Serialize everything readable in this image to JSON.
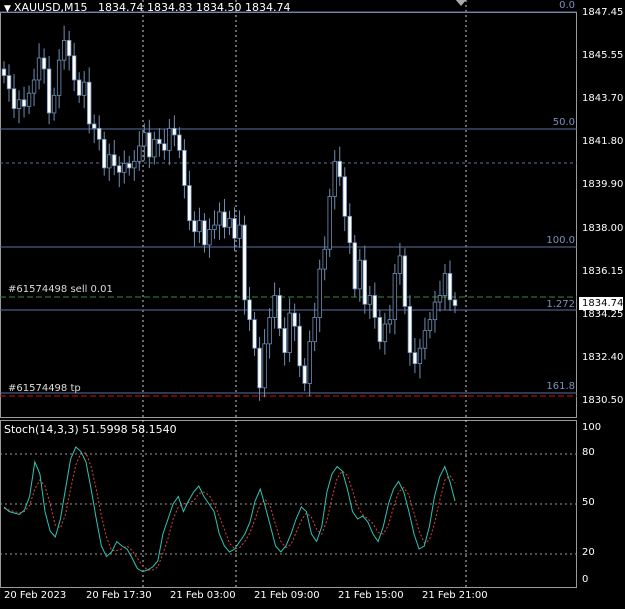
{
  "header": {
    "symbol": "XAUUSD,M15",
    "open": "1834.74",
    "high": "1834.83",
    "low": "1834.50",
    "close": "1834.74"
  },
  "price_axis": [
    "1847.45",
    "1845.55",
    "1843.70",
    "1841.80",
    "1839.90",
    "1838.00",
    "1836.15",
    "1834.25",
    "1832.40",
    "1830.50"
  ],
  "current_price": "1834.74",
  "time_axis": [
    "20 Feb 2023",
    "20 Feb 17:30",
    "21 Feb 03:00",
    "21 Feb 09:00",
    "21 Feb 15:00",
    "21 Feb 21:00"
  ],
  "fibo_labels": [
    "0.0",
    "50.0",
    "100.0",
    "1.272",
    "161.8"
  ],
  "orders": {
    "sell_label": "#61574498 sell 0.01",
    "tp_label": "#61574498 tp"
  },
  "stoch": {
    "label": "Stoch(14,3,3) 51.5998 58.1540",
    "axis": [
      "100",
      "80",
      "50",
      "20",
      "0"
    ]
  },
  "colors": {
    "background": "#000000",
    "candle": "#6f8fb5",
    "grid": "#9a9a9a",
    "fibo": "#5b6f9e",
    "sell_line": "#3a8a3a",
    "tp_line": "#d01010",
    "stoch_main": "#2ec4b6",
    "stoch_signal": "#e04040"
  },
  "chart_data": {
    "type": "candlestick",
    "symbol": "XAUUSD,M15",
    "ylim": [
      1829.9,
      1848.0
    ],
    "closes": [
      1845.2,
      1844.6,
      1843.7,
      1844.1,
      1843.8,
      1844.4,
      1845.0,
      1846.0,
      1845.5,
      1843.5,
      1844.3,
      1845.9,
      1846.8,
      1846.1,
      1845.0,
      1844.3,
      1844.9,
      1843.0,
      1842.8,
      1842.3,
      1841.0,
      1841.6,
      1841.1,
      1840.8,
      1841.2,
      1841.0,
      1841.3,
      1842.0,
      1842.6,
      1841.5,
      1842.3,
      1842.1,
      1841.8,
      1842.8,
      1842.5,
      1841.8,
      1840.2,
      1838.6,
      1838.1,
      1838.6,
      1837.5,
      1838.2,
      1838.4,
      1839.0,
      1838.3,
      1838.7,
      1837.8,
      1838.4,
      1835.0,
      1834.1,
      1832.8,
      1831.0,
      1833.0,
      1834.2,
      1835.2,
      1833.7,
      1832.6,
      1834.4,
      1833.8,
      1832.0,
      1831.2,
      1833.1,
      1834.2,
      1836.4,
      1837.3,
      1839.7,
      1841.3,
      1840.6,
      1838.8,
      1837.6,
      1835.5,
      1836.8,
      1834.8,
      1835.2,
      1834.2,
      1833.1,
      1833.9,
      1834.1,
      1836.2,
      1837.0,
      1834.7,
      1832.6,
      1832.1,
      1832.8,
      1833.6,
      1834.1,
      1834.9,
      1835.2,
      1836.2,
      1835.0,
      1834.74
    ],
    "stoch_main": [
      48,
      45,
      44,
      43,
      46,
      55,
      78,
      70,
      45,
      32,
      28,
      40,
      60,
      80,
      88,
      85,
      78,
      60,
      40,
      22,
      15,
      18,
      25,
      22,
      20,
      14,
      7,
      5,
      6,
      8,
      12,
      30,
      40,
      50,
      55,
      45,
      52,
      58,
      62,
      55,
      50,
      45,
      30,
      22,
      18,
      20,
      25,
      30,
      38,
      52,
      60,
      48,
      35,
      22,
      18,
      22,
      30,
      40,
      48,
      45,
      30,
      25,
      35,
      58,
      70,
      75,
      72,
      60,
      45,
      40,
      42,
      38,
      30,
      25,
      35,
      50,
      60,
      65,
      58,
      45,
      30,
      20,
      22,
      35,
      55,
      68,
      75,
      65,
      52
    ],
    "stoch_signal": [
      47,
      46,
      45,
      44,
      45,
      49,
      60,
      66,
      62,
      50,
      36,
      34,
      43,
      60,
      76,
      84,
      84,
      75,
      60,
      42,
      28,
      19,
      19,
      20,
      22,
      19,
      14,
      9,
      6,
      6,
      8,
      17,
      27,
      40,
      48,
      50,
      51,
      52,
      57,
      58,
      56,
      50,
      42,
      33,
      24,
      20,
      21,
      25,
      31,
      40,
      50,
      53,
      48,
      36,
      25,
      21,
      23,
      31,
      39,
      44,
      41,
      33,
      30,
      39,
      54,
      67,
      72,
      69,
      59,
      48,
      43,
      40,
      37,
      31,
      30,
      36,
      48,
      58,
      61,
      56,
      44,
      32,
      24,
      26,
      37,
      52,
      66,
      69,
      64
    ]
  }
}
